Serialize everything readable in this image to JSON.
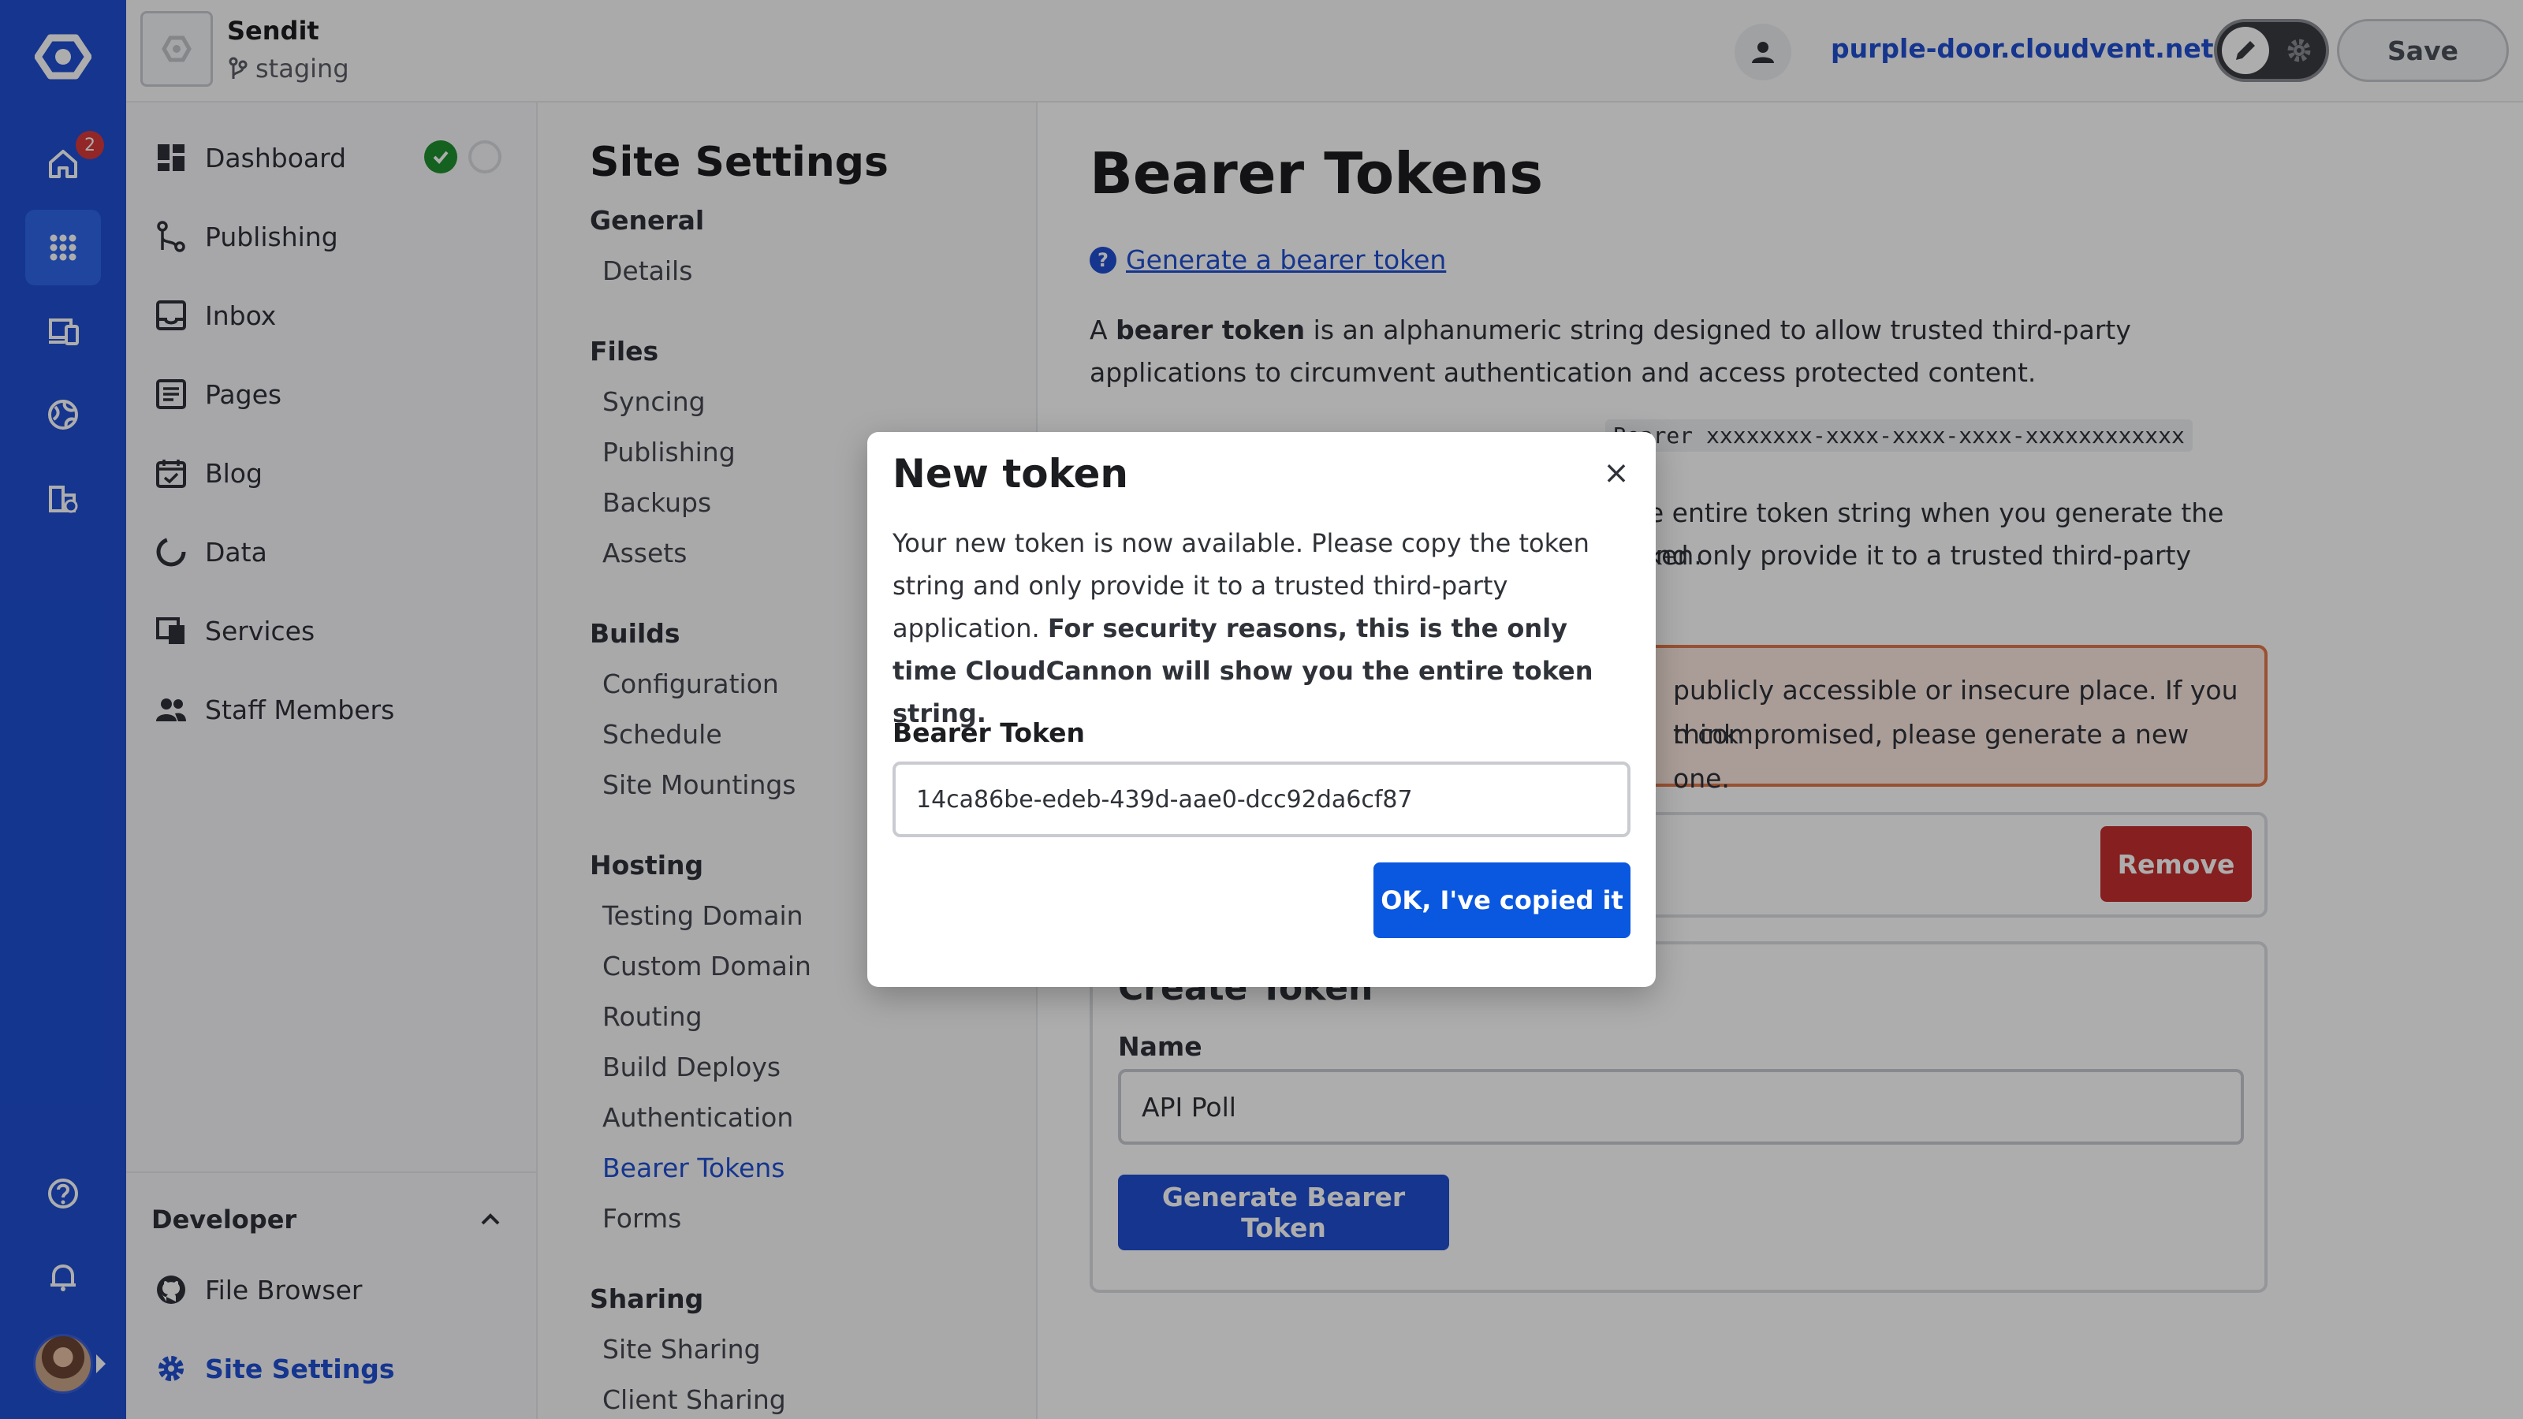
{
  "site": {
    "name": "Sendit",
    "branch": "staging"
  },
  "topbar": {
    "site_url": "purple-door.cloudvent.net",
    "save_label": "Save"
  },
  "rail": {
    "badge_count": "2"
  },
  "nav": {
    "items": [
      {
        "label": "Dashboard",
        "icon": "dashboard-icon"
      },
      {
        "label": "Publishing",
        "icon": "publishing-icon"
      },
      {
        "label": "Inbox",
        "icon": "inbox-icon"
      },
      {
        "label": "Pages",
        "icon": "pages-icon"
      },
      {
        "label": "Blog",
        "icon": "blog-icon"
      },
      {
        "label": "Data",
        "icon": "data-icon"
      },
      {
        "label": "Services",
        "icon": "services-icon"
      },
      {
        "label": "Staff Members",
        "icon": "staff-icon"
      }
    ],
    "developer": {
      "title": "Developer",
      "items": [
        {
          "label": "File Browser",
          "icon": "github-icon"
        },
        {
          "label": "Site Settings",
          "icon": "gear-icon"
        }
      ]
    }
  },
  "settings": {
    "title": "Site Settings",
    "groups": {
      "general": {
        "label": "General",
        "items": [
          "Details"
        ]
      },
      "files": {
        "label": "Files",
        "items": [
          "Syncing",
          "Publishing",
          "Backups",
          "Assets"
        ]
      },
      "builds": {
        "label": "Builds",
        "items": [
          "Configuration",
          "Schedule",
          "Site Mountings"
        ]
      },
      "hosting": {
        "label": "Hosting",
        "items": [
          "Testing Domain",
          "Custom Domain",
          "Routing",
          "Build Deploys",
          "Authentication",
          "Bearer Tokens",
          "Forms"
        ]
      },
      "sharing": {
        "label": "Sharing",
        "items": [
          "Site Sharing",
          "Client Sharing"
        ]
      }
    }
  },
  "content": {
    "title": "Bearer Tokens",
    "help_link": "Generate a bearer token",
    "intro_bold": "bearer token",
    "intro_rest": " is an alphanumeric string designed to allow trusted third-party applications to circumvent authentication and access protected content.",
    "intro_prefix": "A ",
    "code_example": "Bearer xxxxxxxx-xxxx-xxxx-xxxx-xxxxxxxxxxxx",
    "copy_note_a": "the entire token string when you generate the token.",
    "copy_note_b": "t and only provide it to a trusted third-party",
    "warning_a": "publicly accessible or insecure place. If you think",
    "warning_b": "n compromised, please generate a new one.",
    "remove_label": "Remove",
    "create": {
      "title": "Create Token",
      "name_label": "Name",
      "name_value": "API Poll",
      "generate_label": "Generate Bearer Token"
    }
  },
  "modal": {
    "title": "New token",
    "body_plain": "Your new token is now available. Please copy the token string and only provide it to a trusted third-party application. ",
    "body_bold": "For security reasons, this is the only time CloudCannon will show you the entire token string.",
    "token_label": "Bearer Token",
    "token_value": "14ca86be-edeb-439d-aae0-dcc92da6cf87",
    "ok_label": "OK, I've copied it",
    "close_glyph": "×"
  }
}
